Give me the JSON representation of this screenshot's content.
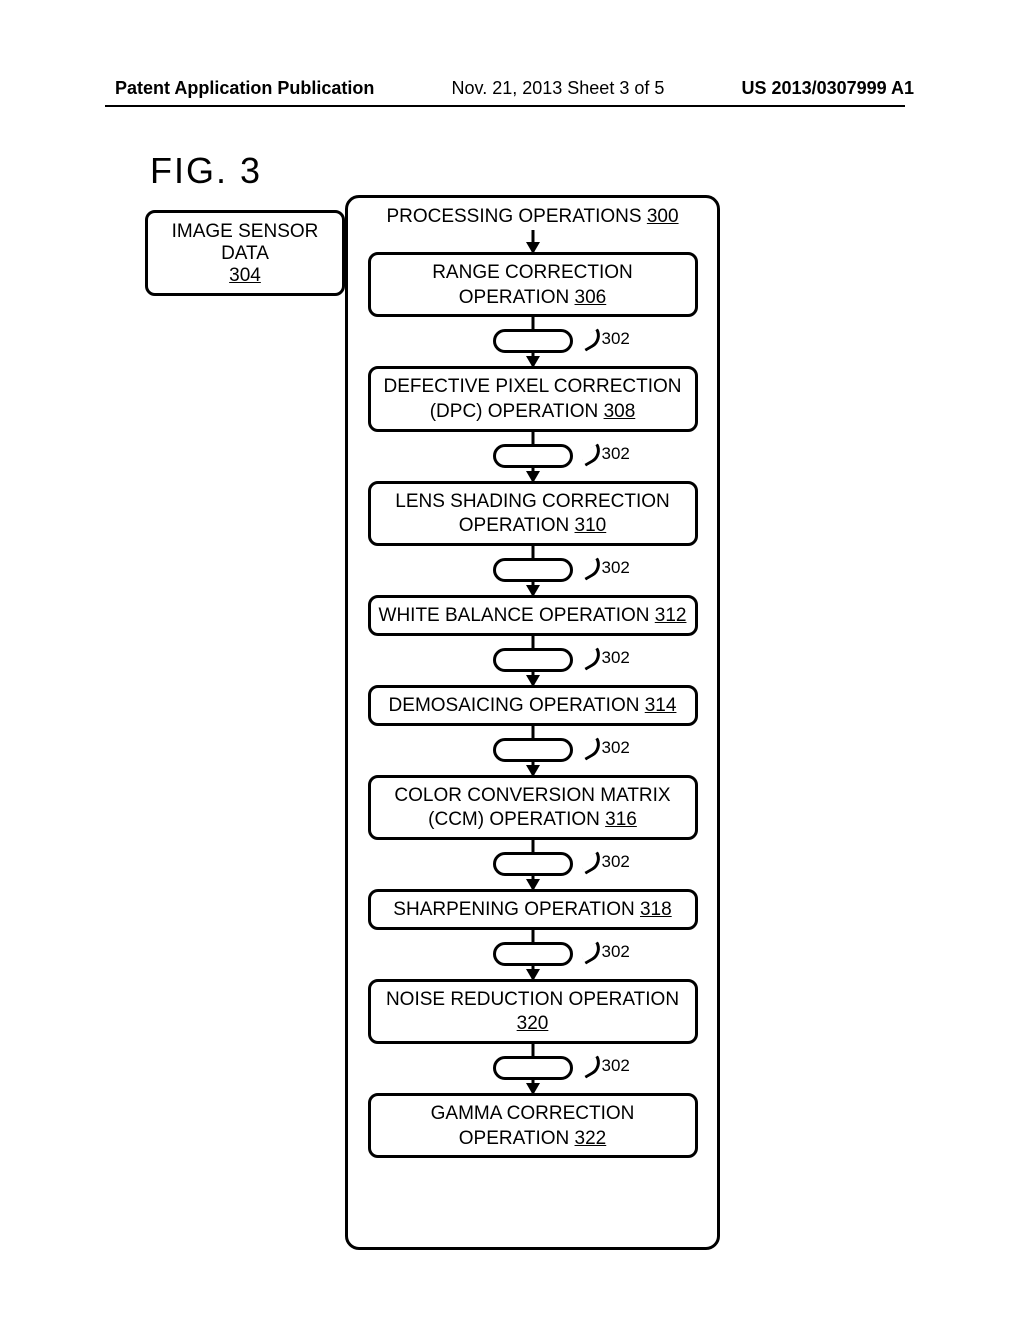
{
  "header": {
    "left": "Patent Application Publication",
    "mid": "Nov. 21, 2013  Sheet 3 of 5",
    "right": "US 2013/0307999 A1"
  },
  "figure_label": "FIG. 3",
  "input_box": {
    "label": "IMAGE SENSOR DATA",
    "ref": "304"
  },
  "container": {
    "title": "PROCESSING OPERATIONS",
    "ref": "300"
  },
  "buffer_ref": "302",
  "operations": [
    {
      "label": "RANGE CORRECTION OPERATION",
      "ref": "306"
    },
    {
      "label": "DEFECTIVE PIXEL CORRECTION (DPC) OPERATION",
      "ref": "308"
    },
    {
      "label": "LENS SHADING CORRECTION OPERATION",
      "ref": "310"
    },
    {
      "label": "WHITE BALANCE OPERATION",
      "ref": "312"
    },
    {
      "label": "DEMOSAICING OPERATION",
      "ref": "314"
    },
    {
      "label": "COLOR CONVERSION MATRIX (CCM) OPERATION",
      "ref": "316"
    },
    {
      "label": "SHARPENING OPERATION",
      "ref": "318"
    },
    {
      "label": "NOISE REDUCTION OPERATION",
      "ref": "320"
    },
    {
      "label": "GAMMA CORRECTION OPERATION",
      "ref": "322"
    }
  ],
  "chart_data": {
    "type": "flowchart",
    "title": "FIG. 3",
    "container": {
      "id": "300",
      "label": "PROCESSING OPERATIONS"
    },
    "input": {
      "id": "304",
      "label": "IMAGE SENSOR DATA"
    },
    "buffer_ref": "302",
    "nodes": [
      {
        "id": "306",
        "label": "RANGE CORRECTION OPERATION"
      },
      {
        "id": "308",
        "label": "DEFECTIVE PIXEL CORRECTION (DPC) OPERATION"
      },
      {
        "id": "310",
        "label": "LENS SHADING CORRECTION OPERATION"
      },
      {
        "id": "312",
        "label": "WHITE BALANCE OPERATION"
      },
      {
        "id": "314",
        "label": "DEMOSAICING OPERATION"
      },
      {
        "id": "316",
        "label": "COLOR CONVERSION MATRIX (CCM) OPERATION"
      },
      {
        "id": "318",
        "label": "SHARPENING OPERATION"
      },
      {
        "id": "320",
        "label": "NOISE REDUCTION OPERATION"
      },
      {
        "id": "322",
        "label": "GAMMA CORRECTION OPERATION"
      }
    ],
    "edges": [
      {
        "from": "304",
        "to": "306"
      },
      {
        "from": "306",
        "to": "308",
        "via_buffer": "302"
      },
      {
        "from": "308",
        "to": "310",
        "via_buffer": "302"
      },
      {
        "from": "310",
        "to": "312",
        "via_buffer": "302"
      },
      {
        "from": "312",
        "to": "314",
        "via_buffer": "302"
      },
      {
        "from": "314",
        "to": "316",
        "via_buffer": "302"
      },
      {
        "from": "316",
        "to": "318",
        "via_buffer": "302"
      },
      {
        "from": "318",
        "to": "320",
        "via_buffer": "302"
      },
      {
        "from": "320",
        "to": "322",
        "via_buffer": "302"
      }
    ]
  }
}
